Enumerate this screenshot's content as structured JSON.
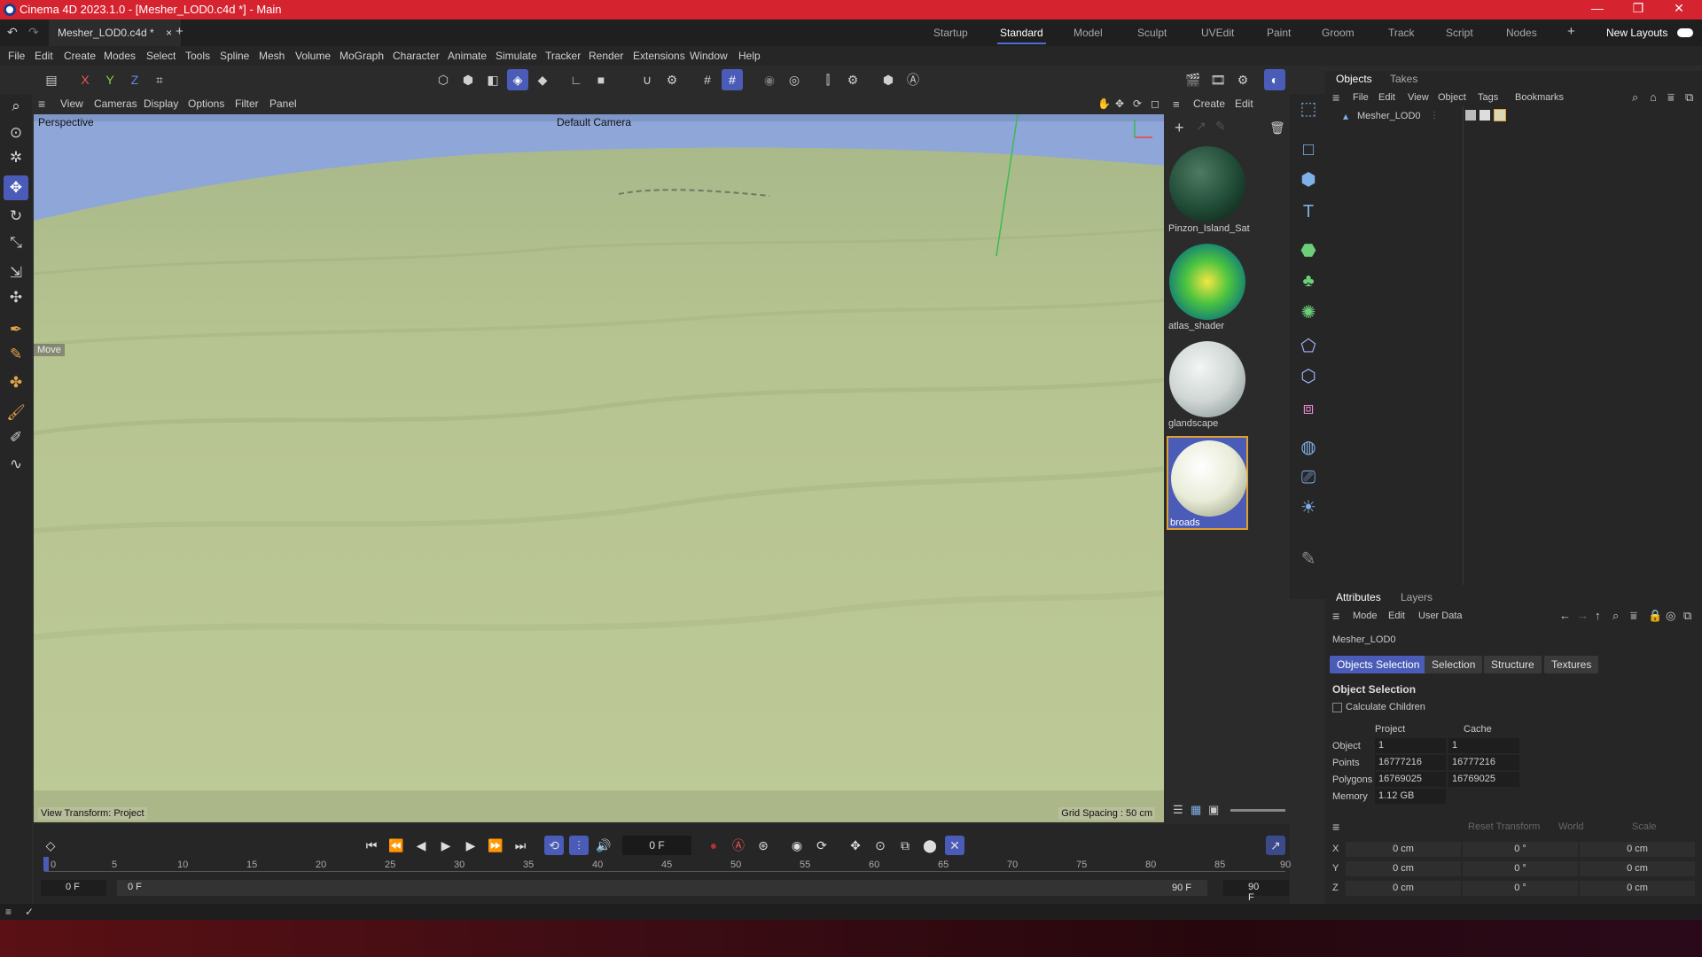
{
  "window": {
    "title": "Cinema 4D 2023.1.0 - [Mesher_LOD0.c4d *] - Main",
    "controls": [
      "—",
      "❐",
      "✕"
    ]
  },
  "tabs": {
    "document": "Mesher_LOD0.c4d *",
    "close": "×",
    "add": "+",
    "layouts": [
      "Startup",
      "Standard",
      "Model",
      "Sculpt",
      "UVEdit",
      "Paint",
      "Groom",
      "Track",
      "Script",
      "Nodes"
    ],
    "active_layout": "Standard",
    "new_layouts": "New Layouts"
  },
  "menu": [
    "File",
    "Edit",
    "Create",
    "Modes",
    "Select",
    "Tools",
    "Spline",
    "Mesh",
    "Volume",
    "MoGraph",
    "Character",
    "Animate",
    "Simulate",
    "Tracker",
    "Render",
    "Extensions",
    "Window",
    "Help"
  ],
  "toolbar": {
    "axes": [
      "X",
      "Y",
      "Z"
    ]
  },
  "viewport": {
    "menu": [
      "View",
      "Cameras",
      "Display",
      "Options",
      "Filter",
      "Panel"
    ],
    "label": "Perspective",
    "camera": "Default Camera",
    "tool_hint": "Move",
    "view_transform": "View Transform: Project",
    "grid_spacing": "Grid Spacing : 50 cm"
  },
  "materials": {
    "menu": [
      "Create",
      "Edit"
    ],
    "items": [
      {
        "name": "Pinzon_Island_Sat",
        "color": "#1f4a35"
      },
      {
        "name": "atlas_shader",
        "color": "#3fb04a"
      },
      {
        "name": "glandscape",
        "color": "#cfd6d4"
      },
      {
        "name": "broads",
        "color": "#e8ecd8"
      }
    ],
    "selected": "broads"
  },
  "objects": {
    "tabs": [
      "Objects",
      "Takes"
    ],
    "menu": [
      "File",
      "Edit",
      "View",
      "Object",
      "Tags",
      "Bookmarks"
    ],
    "items": [
      {
        "name": "Mesher_LOD0"
      }
    ]
  },
  "attributes": {
    "tabs": [
      "Attributes",
      "Layers"
    ],
    "menu": [
      "Mode",
      "Edit",
      "User Data"
    ],
    "object_name": "Mesher_LOD0",
    "buttons": [
      "Objects Selection",
      "Selection",
      "Structure",
      "Textures"
    ],
    "active_button": "Objects Selection",
    "section": "Object Selection",
    "checkbox": "Calculate Children",
    "columns": [
      "Project",
      "Cache"
    ],
    "rows": [
      {
        "label": "Object",
        "project": "1",
        "cache": "1"
      },
      {
        "label": "Points",
        "project": "16777216",
        "cache": "16777216"
      },
      {
        "label": "Polygons",
        "project": "16769025",
        "cache": "16769025"
      },
      {
        "label": "Memory",
        "project": "1.12 GB",
        "cache": ""
      }
    ]
  },
  "coordinates": {
    "reset": "Reset Transform",
    "space": "World",
    "scale": "Scale",
    "rows": [
      {
        "axis": "X",
        "p": "0 cm",
        "r": "0 °",
        "s": "0 cm"
      },
      {
        "axis": "Y",
        "p": "0 cm",
        "r": "0 °",
        "s": "0 cm"
      },
      {
        "axis": "Z",
        "p": "0 cm",
        "r": "0 °",
        "s": "0 cm"
      }
    ]
  },
  "timeline": {
    "current_frame": "0 F",
    "ticks": [
      "0",
      "5",
      "10",
      "15",
      "20",
      "25",
      "30",
      "35",
      "40",
      "45",
      "50",
      "55",
      "60",
      "65",
      "70",
      "75",
      "80",
      "85",
      "90"
    ],
    "start": "0 F",
    "start2": "0 F",
    "end": "90 F",
    "end2": "90 F"
  },
  "colors": {
    "titlebar": "#d5232f",
    "accent": "#4a5cb8",
    "terrain": "#b8c692",
    "sky": "#8fa6d8"
  }
}
